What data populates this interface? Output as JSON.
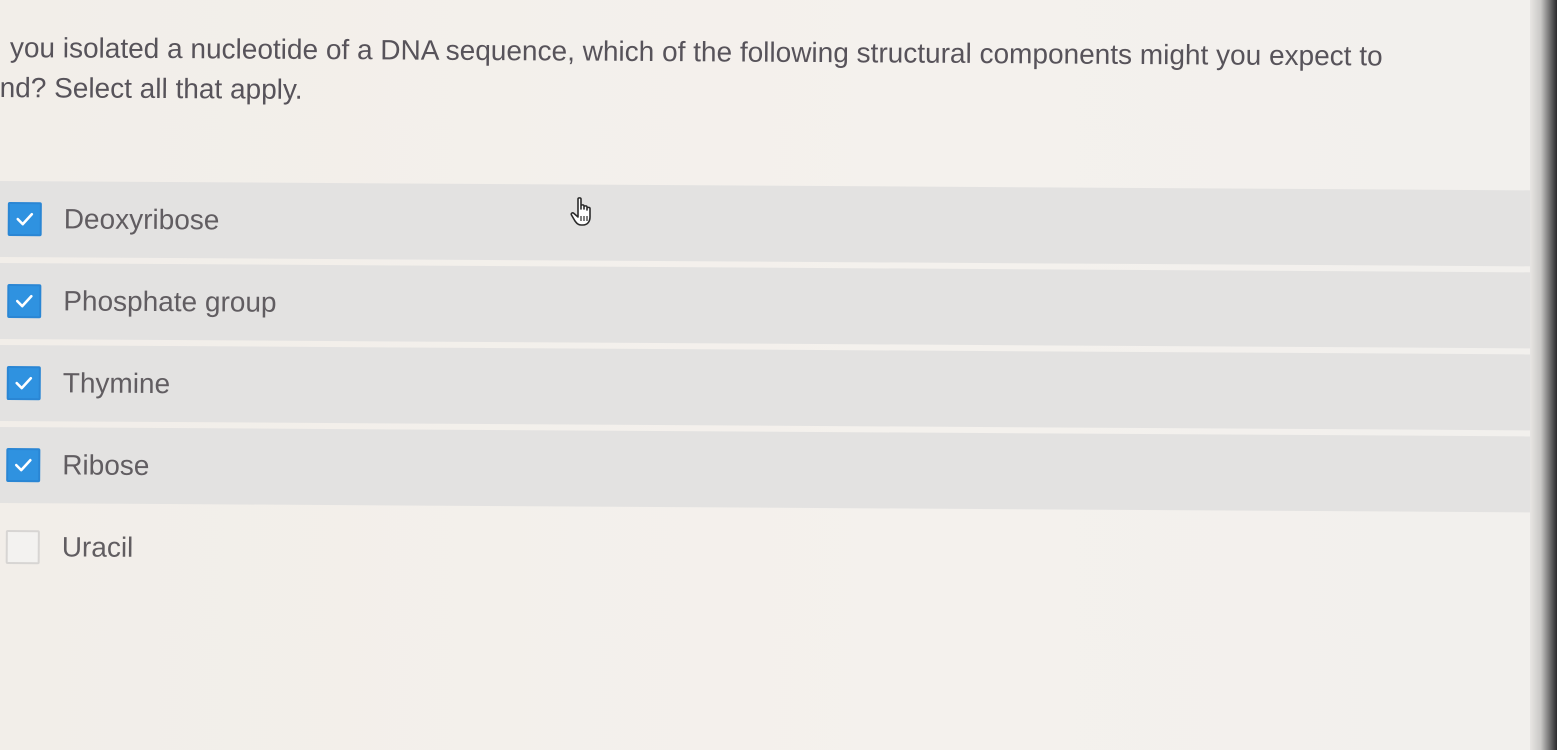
{
  "question": {
    "line1": "you isolated a nucleotide of a DNA sequence, which of the following structural components might you expect to",
    "line2": "nd?  Select all that apply."
  },
  "options": [
    {
      "label": "Deoxyribose",
      "checked": true
    },
    {
      "label": "Phosphate group",
      "checked": true
    },
    {
      "label": "Thymine",
      "checked": true
    },
    {
      "label": "Ribose",
      "checked": true
    },
    {
      "label": "Uracil",
      "checked": false
    }
  ],
  "colors": {
    "checkbox_checked": "#2f92e0",
    "row_checked_bg": "#e3e2e1",
    "text": "#615d61"
  },
  "icons": {
    "check": "checkmark-icon",
    "cursor": "hand-pointer-icon"
  }
}
